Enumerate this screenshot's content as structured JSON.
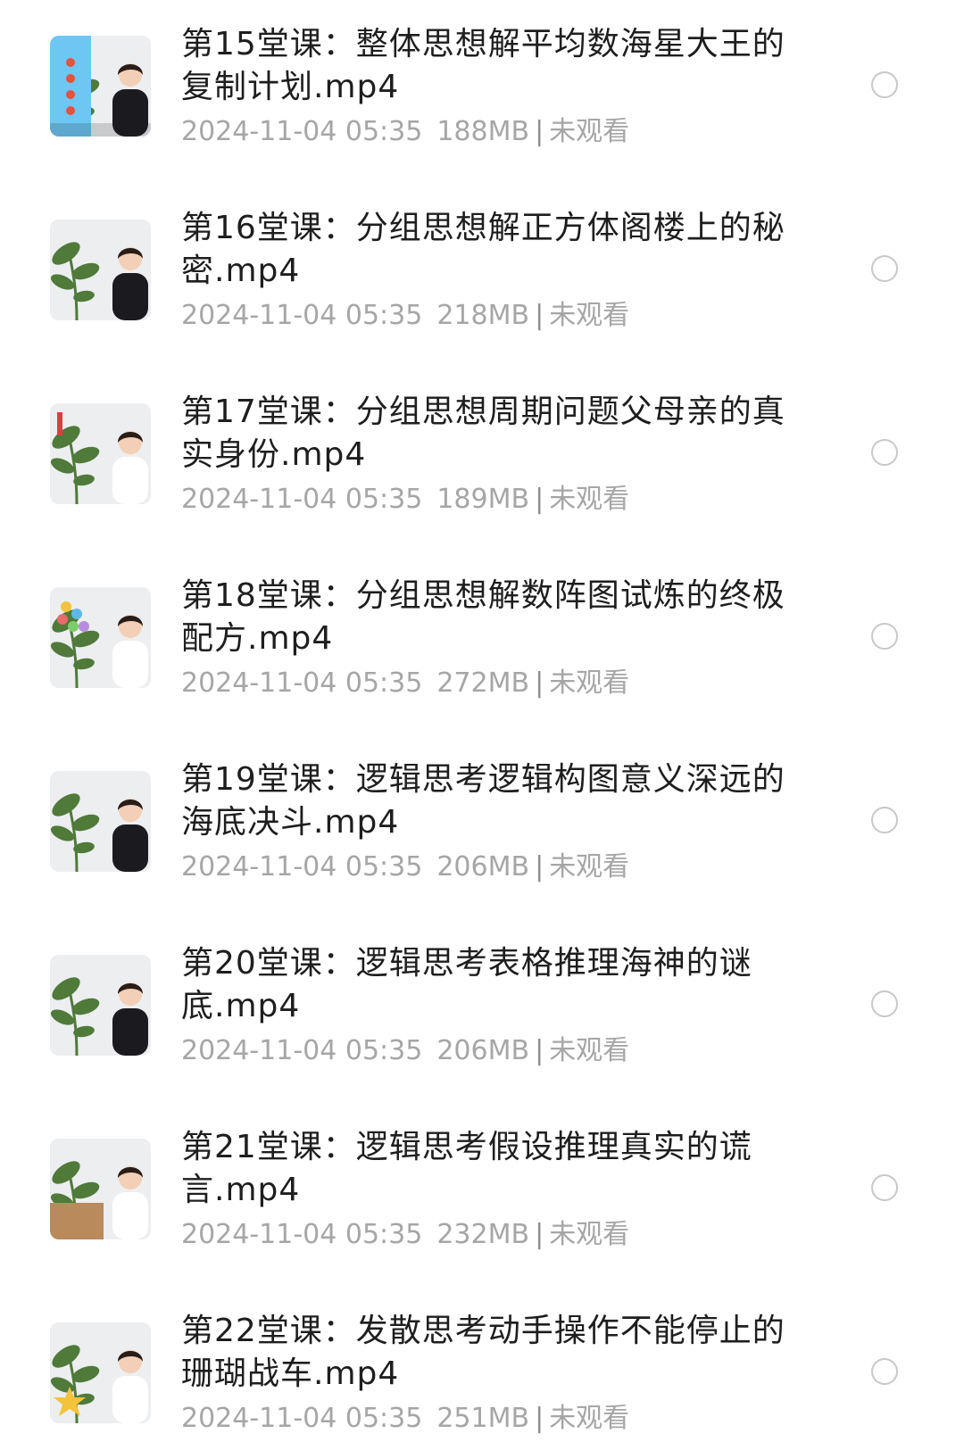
{
  "files": [
    {
      "title": "第15堂课：整体思想解平均数海星大王的复制计划.mp4",
      "date": "2024-11-04 05:35",
      "size": "188MB",
      "status": "未观看",
      "thumb_variant": "blue-panel"
    },
    {
      "title": "第16堂课：分组思想解正方体阁楼上的秘密.mp4",
      "date": "2024-11-04 05:35",
      "size": "218MB",
      "status": "未观看",
      "thumb_variant": "plant-teacher"
    },
    {
      "title": "第17堂课：分组思想周期问题父母亲的真实身份.mp4",
      "date": "2024-11-04 05:35",
      "size": "189MB",
      "status": "未观看",
      "thumb_variant": "plant-teacher-red"
    },
    {
      "title": "第18堂课：分组思想解数阵图试炼的终极配方.mp4",
      "date": "2024-11-04 05:35",
      "size": "272MB",
      "status": "未观看",
      "thumb_variant": "plant-teacher-dots"
    },
    {
      "title": "第19堂课：逻辑思考逻辑构图意义深远的海底决斗.mp4",
      "date": "2024-11-04 05:35",
      "size": "206MB",
      "status": "未观看",
      "thumb_variant": "plant-teacher"
    },
    {
      "title": "第20堂课：逻辑思考表格推理海神的谜底.mp4",
      "date": "2024-11-04 05:35",
      "size": "206MB",
      "status": "未观看",
      "thumb_variant": "plant-teacher"
    },
    {
      "title": "第21堂课：逻辑思考假设推理真实的谎言.mp4",
      "date": "2024-11-04 05:35",
      "size": "232MB",
      "status": "未观看",
      "thumb_variant": "plant-teacher-box"
    },
    {
      "title": "第22堂课：发散思考动手操作不能停止的珊瑚战车.mp4",
      "date": "2024-11-04 05:35",
      "size": "251MB",
      "status": "未观看",
      "thumb_variant": "plant-teacher-star"
    }
  ],
  "separator": "|",
  "colors": {
    "title": "#1e1e1e",
    "meta": "#a6a6a6",
    "radio_border": "#c8c8c8",
    "plant": "#4f7a3a",
    "skin": "#f2cfb6",
    "hair": "#2a1d18",
    "shirt_dark": "#1b1b1f",
    "shirt_light": "#ffffff"
  }
}
